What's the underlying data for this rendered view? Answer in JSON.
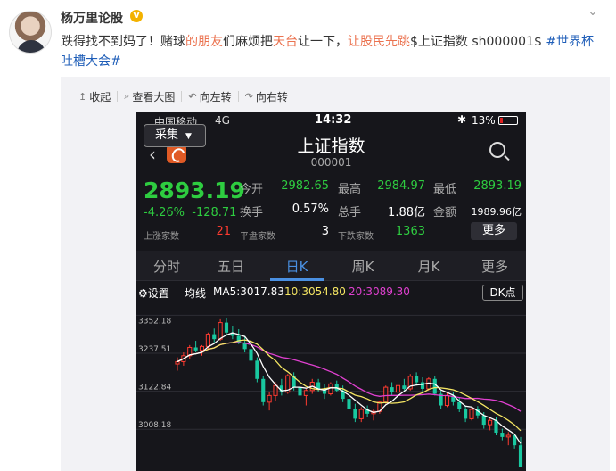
{
  "user": {
    "name": "杨万里论股",
    "verified_badge": "V"
  },
  "more_icon": "chevron-down-icon",
  "post": {
    "parts": [
      {
        "text": "跌得找不到妈了！赌球",
        "style": "plain"
      },
      {
        "text": "的朋友",
        "style": "link"
      },
      {
        "text": "们麻烦把",
        "style": "plain"
      },
      {
        "text": "天台",
        "style": "link"
      },
      {
        "text": "让一下，",
        "style": "plain"
      },
      {
        "text": "让股民先跳",
        "style": "link"
      },
      {
        "text": "$上证指数 sh000001$",
        "style": "plain"
      },
      {
        "text": " #世界杯吐槽大会#",
        "style": "topic"
      }
    ]
  },
  "toolbar": {
    "collapse": "收起",
    "view_large": "查看大图",
    "rotate_left": "向左转",
    "rotate_right": "向右转"
  },
  "phone": {
    "status": {
      "carrier": "中国移动",
      "network": "4G",
      "time": "14:32",
      "bluetooth": "✱",
      "battery": "13%"
    },
    "collect": "采集",
    "back": "‹",
    "title": "上证指数",
    "code": "000001",
    "price": "2893.19",
    "change_pct": "-4.26%",
    "change_abs": "-128.71",
    "quotes": {
      "open_label": "今开",
      "open": "2982.65",
      "high_label": "最高",
      "high": "2984.97",
      "low_label": "最低",
      "low": "2893.19",
      "turnover_label": "换手",
      "turnover": "0.57%",
      "volume_label": "总手",
      "volume": "1.88亿",
      "amount_label": "金额",
      "amount": "1989.96亿",
      "up_label": "上涨家数",
      "up": "21",
      "flat_label": "平盘家数",
      "flat": "3",
      "down_label": "下跌家数",
      "down": "1363",
      "more": "更多"
    },
    "tabs": [
      "分时",
      "五日",
      "日K",
      "周K",
      "月K",
      "更多"
    ],
    "active_tab": 2,
    "ctrl": {
      "settings": "⚙设置",
      "ma_label": "均线",
      "ma5": "MA5:3017.83",
      "ma10": "10:3054.80",
      "ma20": "20:3089.30",
      "dk": "DK点"
    },
    "colors": {
      "up": "#ff3b30",
      "down": "#19c8a0",
      "ma5": "#ffffff",
      "ma10": "#f5e663",
      "ma20": "#e040d0"
    }
  },
  "chart_data": {
    "type": "candlestick",
    "y_ticks": [
      "3352.18",
      "3237.51",
      "3122.84",
      "3008.18"
    ],
    "ylim": [
      2893.19,
      3380
    ],
    "candles": [
      {
        "o": 3205,
        "h": 3225,
        "l": 3185,
        "c": 3212
      },
      {
        "o": 3212,
        "h": 3240,
        "l": 3200,
        "c": 3230
      },
      {
        "o": 3230,
        "h": 3262,
        "l": 3220,
        "c": 3255
      },
      {
        "o": 3255,
        "h": 3275,
        "l": 3240,
        "c": 3246
      },
      {
        "o": 3246,
        "h": 3262,
        "l": 3230,
        "c": 3258
      },
      {
        "o": 3258,
        "h": 3300,
        "l": 3250,
        "c": 3295
      },
      {
        "o": 3295,
        "h": 3312,
        "l": 3270,
        "c": 3280
      },
      {
        "o": 3280,
        "h": 3340,
        "l": 3275,
        "c": 3330
      },
      {
        "o": 3330,
        "h": 3345,
        "l": 3290,
        "c": 3300
      },
      {
        "o": 3300,
        "h": 3320,
        "l": 3280,
        "c": 3290
      },
      {
        "o": 3290,
        "h": 3310,
        "l": 3265,
        "c": 3270
      },
      {
        "o": 3270,
        "h": 3290,
        "l": 3240,
        "c": 3250
      },
      {
        "o": 3250,
        "h": 3265,
        "l": 3205,
        "c": 3215
      },
      {
        "o": 3215,
        "h": 3225,
        "l": 3150,
        "c": 3160
      },
      {
        "o": 3160,
        "h": 3170,
        "l": 3080,
        "c": 3090
      },
      {
        "o": 3090,
        "h": 3120,
        "l": 3065,
        "c": 3110
      },
      {
        "o": 3110,
        "h": 3150,
        "l": 3095,
        "c": 3140
      },
      {
        "o": 3140,
        "h": 3160,
        "l": 3110,
        "c": 3120
      },
      {
        "o": 3120,
        "h": 3175,
        "l": 3115,
        "c": 3170
      },
      {
        "o": 3170,
        "h": 3180,
        "l": 3125,
        "c": 3135
      },
      {
        "o": 3135,
        "h": 3150,
        "l": 3100,
        "c": 3110
      },
      {
        "o": 3110,
        "h": 3130,
        "l": 3080,
        "c": 3125
      },
      {
        "o": 3125,
        "h": 3160,
        "l": 3115,
        "c": 3150
      },
      {
        "o": 3150,
        "h": 3160,
        "l": 3120,
        "c": 3130
      },
      {
        "o": 3130,
        "h": 3145,
        "l": 3100,
        "c": 3115
      },
      {
        "o": 3115,
        "h": 3150,
        "l": 3110,
        "c": 3145
      },
      {
        "o": 3145,
        "h": 3155,
        "l": 3120,
        "c": 3125
      },
      {
        "o": 3125,
        "h": 3140,
        "l": 3090,
        "c": 3100
      },
      {
        "o": 3100,
        "h": 3115,
        "l": 3060,
        "c": 3070
      },
      {
        "o": 3070,
        "h": 3085,
        "l": 3030,
        "c": 3040
      },
      {
        "o": 3040,
        "h": 3075,
        "l": 3030,
        "c": 3068
      },
      {
        "o": 3068,
        "h": 3080,
        "l": 3045,
        "c": 3055
      },
      {
        "o": 3055,
        "h": 3070,
        "l": 3035,
        "c": 3062
      },
      {
        "o": 3062,
        "h": 3095,
        "l": 3055,
        "c": 3090
      },
      {
        "o": 3090,
        "h": 3140,
        "l": 3085,
        "c": 3135
      },
      {
        "o": 3135,
        "h": 3150,
        "l": 3110,
        "c": 3120
      },
      {
        "o": 3120,
        "h": 3145,
        "l": 3105,
        "c": 3140
      },
      {
        "o": 3140,
        "h": 3160,
        "l": 3125,
        "c": 3130
      },
      {
        "o": 3130,
        "h": 3175,
        "l": 3125,
        "c": 3168
      },
      {
        "o": 3168,
        "h": 3180,
        "l": 3140,
        "c": 3150
      },
      {
        "o": 3150,
        "h": 3165,
        "l": 3120,
        "c": 3130
      },
      {
        "o": 3130,
        "h": 3165,
        "l": 3125,
        "c": 3160
      },
      {
        "o": 3160,
        "h": 3170,
        "l": 3110,
        "c": 3115
      },
      {
        "o": 3115,
        "h": 3125,
        "l": 3070,
        "c": 3080
      },
      {
        "o": 3080,
        "h": 3120,
        "l": 3075,
        "c": 3110
      },
      {
        "o": 3110,
        "h": 3120,
        "l": 3080,
        "c": 3090
      },
      {
        "o": 3090,
        "h": 3105,
        "l": 3060,
        "c": 3070
      },
      {
        "o": 3070,
        "h": 3080,
        "l": 3030,
        "c": 3040
      },
      {
        "o": 3040,
        "h": 3075,
        "l": 3035,
        "c": 3068
      },
      {
        "o": 3068,
        "h": 3078,
        "l": 3040,
        "c": 3050
      },
      {
        "o": 3050,
        "h": 3060,
        "l": 3010,
        "c": 3022
      },
      {
        "o": 3022,
        "h": 3045,
        "l": 3005,
        "c": 3035
      },
      {
        "o": 3035,
        "h": 3045,
        "l": 2990,
        "c": 2998
      },
      {
        "o": 2998,
        "h": 3010,
        "l": 2975,
        "c": 2985
      },
      {
        "o": 2985,
        "h": 3000,
        "l": 2960,
        "c": 2990
      },
      {
        "o": 2990,
        "h": 2995,
        "l": 2950,
        "c": 2960
      },
      {
        "o": 2960,
        "h": 2984.97,
        "l": 2893.19,
        "c": 2893.19
      }
    ]
  }
}
